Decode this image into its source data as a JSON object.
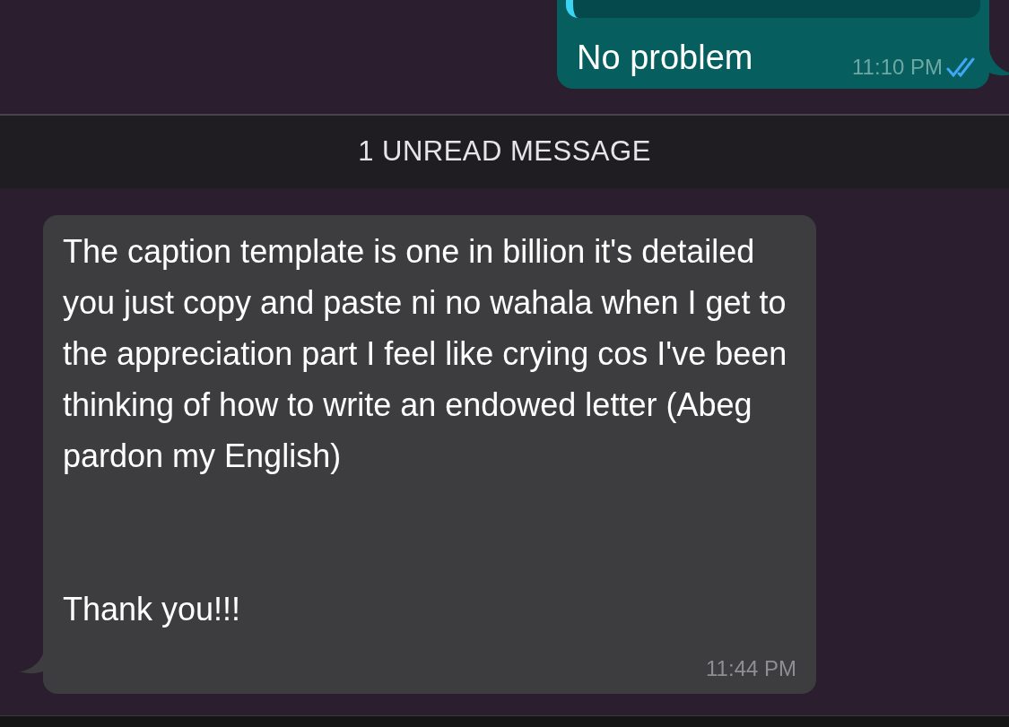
{
  "messages": [
    {
      "kind": "outgoing",
      "has_quote": true,
      "text": "No problem",
      "time": "11:10 PM",
      "read": true
    },
    {
      "kind": "divider",
      "text": "1 UNREAD MESSAGE"
    },
    {
      "kind": "incoming",
      "text": "The caption template is one in billion it's detailed you just copy and paste ni no wahala when I get to the appreciation part I feel like crying cos I've been thinking of how to write an endowed letter (Abeg pardon my English)\n\n\nThank you!!!",
      "time": "11:44 PM"
    }
  ]
}
